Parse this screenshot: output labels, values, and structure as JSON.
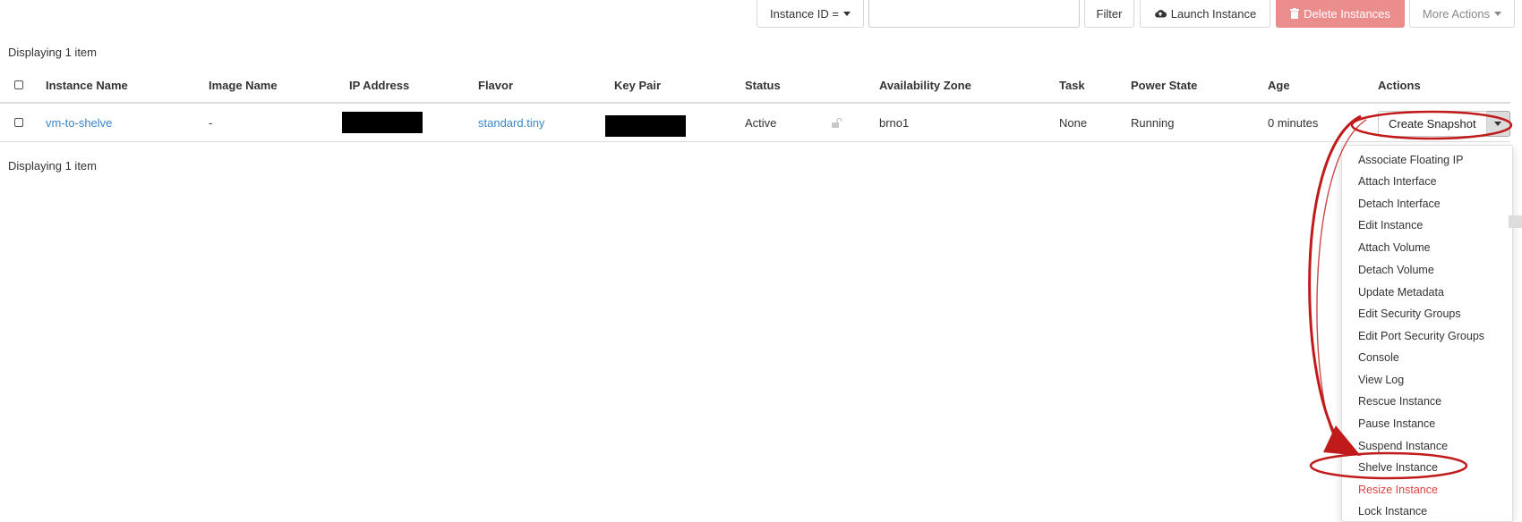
{
  "toolbar": {
    "filter_field": "Instance ID =",
    "filter_value": "",
    "filter_button": "Filter",
    "launch_button": "Launch Instance",
    "delete_button": "Delete Instances",
    "more_actions": "More Actions"
  },
  "displaying_top": "Displaying 1 item",
  "displaying_bottom": "Displaying 1 item",
  "table": {
    "headers": [
      "Instance Name",
      "Image Name",
      "IP Address",
      "Flavor",
      "Key Pair",
      "Status",
      "Availability Zone",
      "Task",
      "Power State",
      "Age",
      "Actions"
    ],
    "rows": [
      {
        "instance_name": "vm-to-shelve",
        "image_name": "-",
        "ip_address": "",
        "flavor": "standard.tiny",
        "key_pair": "",
        "status": "Active",
        "availability_zone": "brno1",
        "task": "None",
        "power_state": "Running",
        "age": "0 minutes",
        "action_primary": "Create Snapshot"
      }
    ]
  },
  "actions_menu": [
    "Associate Floating IP",
    "Attach Interface",
    "Detach Interface",
    "Edit Instance",
    "Attach Volume",
    "Detach Volume",
    "Update Metadata",
    "Edit Security Groups",
    "Edit Port Security Groups",
    "Console",
    "View Log",
    "Rescue Instance",
    "Pause Instance",
    "Suspend Instance",
    "Shelve Instance",
    "Resize Instance",
    "Lock Instance"
  ],
  "colors": {
    "link": "#3a86c8",
    "danger_button": "#eb8d8d",
    "danger_text": "#e04040",
    "annotation": "#c01a1a"
  },
  "icons": {
    "launch": "cloud-upload-icon",
    "delete": "trash-icon",
    "status_lock": "unlock-icon"
  }
}
